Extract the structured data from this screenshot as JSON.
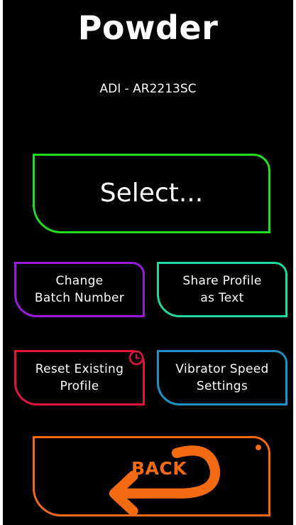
{
  "screen": {
    "title": "Powder",
    "subtitle": "ADI - AR2213SC"
  },
  "buttons": {
    "select": "Select...",
    "change_batch": "Change\nBatch Number",
    "share_profile": "Share Profile\nas Text",
    "reset_profile": "Reset Existing\nProfile",
    "vibrator_speed": "Vibrator Speed\nSettings",
    "back": "BACK"
  },
  "icons": {
    "reset_badge": "clock-icon",
    "back_arrow": "back-arrow-icon",
    "back_indicator": "dot-indicator-icon"
  },
  "colors": {
    "select_border": "#22dd22",
    "batch_border": "#9a1bd8",
    "share_border": "#20d9a0",
    "reset_border": "#e0163c",
    "vibrator_border": "#1f93c4",
    "back_accent": "#f26b12",
    "background": "#000000",
    "text": "#ffffff"
  }
}
